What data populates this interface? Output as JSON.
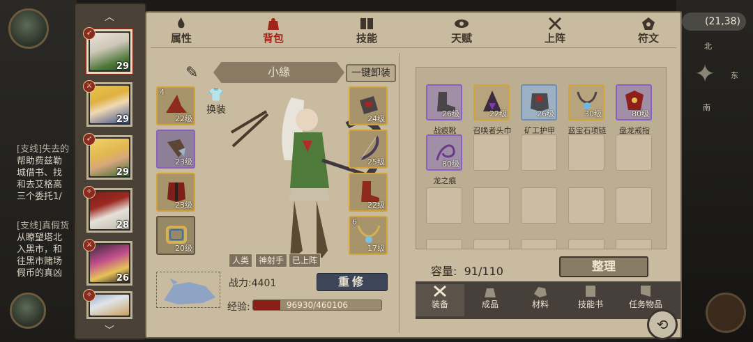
{
  "colors": {
    "parchment": "#c9bba0",
    "active_tab": "#a0241a",
    "gold_border": "#d3a43a",
    "purple_border": "#8c5fc4",
    "exp_fill": "#8b1f18"
  },
  "hud": {
    "coords": "(21,38)",
    "compass": {
      "north": "北",
      "east": "东",
      "south": "南"
    }
  },
  "quest_log": [
    {
      "title": "[支线]失去的",
      "lines": [
        "帮助费兹勒",
        "城借书、找",
        "和去艾格高",
        "三个委托1/"
      ]
    },
    {
      "title": "[支线]真假货",
      "lines": [
        "从瞭望塔北",
        "入黑市，和",
        "往黑市赌场",
        "假币的真凶"
      ]
    }
  ],
  "characters": [
    {
      "level": "29",
      "class_icon": "bow-icon",
      "selected": true
    },
    {
      "level": "29",
      "class_icon": "sword-icon"
    },
    {
      "level": "29",
      "class_icon": "bow-icon"
    },
    {
      "level": "28",
      "class_icon": "staff-icon"
    },
    {
      "level": "26",
      "class_icon": "sword-icon"
    },
    {
      "level": "",
      "class_icon": "staff-icon"
    }
  ],
  "tabs": [
    {
      "label": "属性",
      "icon": "flame-icon"
    },
    {
      "label": "背包",
      "icon": "bag-icon",
      "active": true
    },
    {
      "label": "技能",
      "icon": "book-icon"
    },
    {
      "label": "天赋",
      "icon": "eye-icon"
    },
    {
      "label": "上阵",
      "icon": "crossed-swords-icon"
    },
    {
      "label": "符文",
      "icon": "rune-icon"
    }
  ],
  "hero": {
    "name": "小緣",
    "unequip_all": "一键卸装",
    "swap": "换装",
    "tags": [
      "人类",
      "神射手",
      "已上阵"
    ],
    "power_label": "战力:",
    "power_value": "4401",
    "rebuild": "重修",
    "exp_label": "经验:",
    "exp_text": "96930/460106",
    "exp_fraction": 0.21
  },
  "equipment": {
    "left": [
      {
        "count": "4",
        "level": "22级",
        "icon": "hat-icon"
      },
      {
        "count": "",
        "level": "23级",
        "icon": "glove-icon"
      },
      {
        "count": "",
        "level": "23级",
        "icon": "armor-icon"
      },
      {
        "count": "",
        "level": "20级",
        "icon": "ring-icon"
      }
    ],
    "right": [
      {
        "count": "",
        "level": "24级",
        "icon": "bracer-icon"
      },
      {
        "count": "",
        "level": "25级",
        "icon": "bow-icon"
      },
      {
        "count": "",
        "level": "22级",
        "icon": "boots-icon"
      },
      {
        "count": "6",
        "level": "17级",
        "icon": "necklace-icon"
      }
    ]
  },
  "inventory": {
    "items": [
      {
        "name": "战痕靴",
        "level": "26级",
        "icon": "boots-icon"
      },
      {
        "name": "召唤者头巾",
        "level": "22级",
        "icon": "hood-icon"
      },
      {
        "name": "矿工护甲",
        "level": "26级",
        "icon": "armor-icon"
      },
      {
        "name": "蓝宝石项链",
        "level": "30级",
        "icon": "necklace-icon"
      },
      {
        "name": "盘龙戒指",
        "level": "80级",
        "icon": "ring-icon"
      },
      {
        "name": "龙之痕",
        "level": "80级",
        "icon": "whip-icon"
      }
    ],
    "capacity_label": "容量:",
    "capacity_value": "91/110",
    "sort": "整理"
  },
  "categories": [
    {
      "label": "装备",
      "icon": "hammer-icon",
      "active": true
    },
    {
      "label": "成品",
      "icon": "sack-icon"
    },
    {
      "label": "材料",
      "icon": "ore-icon"
    },
    {
      "label": "技能书",
      "icon": "scroll-icon"
    },
    {
      "label": "任务物品",
      "icon": "quest-scroll-icon"
    }
  ]
}
